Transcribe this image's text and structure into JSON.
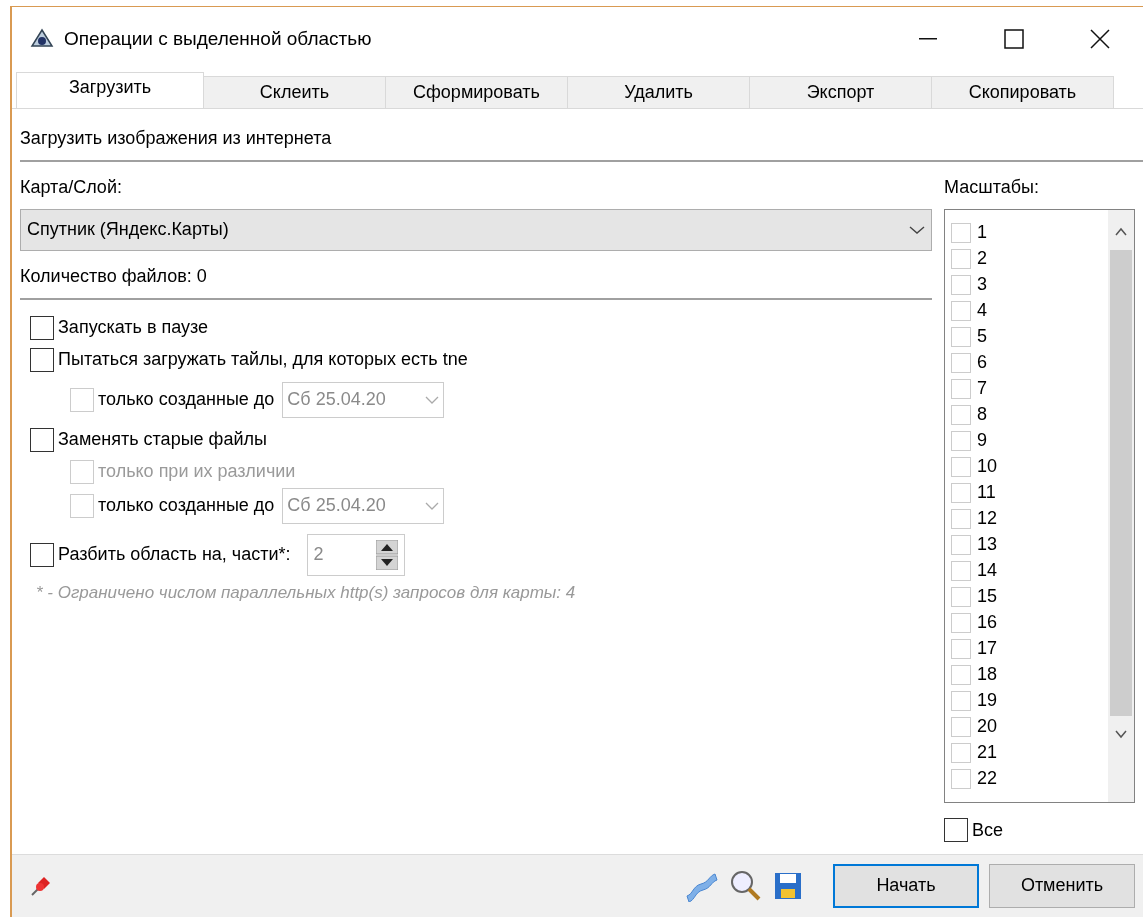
{
  "window": {
    "title": "Операции с выделенной областью"
  },
  "tabs": [
    {
      "label": "Загрузить",
      "selected": true
    },
    {
      "label": "Склеить",
      "selected": false
    },
    {
      "label": "Сформировать",
      "selected": false
    },
    {
      "label": "Удалить",
      "selected": false
    },
    {
      "label": "Экспорт",
      "selected": false
    },
    {
      "label": "Скопировать",
      "selected": false
    }
  ],
  "section_title": "Загрузить изображения из интернета",
  "map_layer": {
    "label": "Карта/Слой:",
    "value": "Спутник (Яндекс.Карты)"
  },
  "file_count": "Количество файлов: 0",
  "options": [
    {
      "kind": "checkbox",
      "label": "Запускать в паузе",
      "checked": false,
      "disabled": false,
      "dimmed": false
    },
    {
      "kind": "checkbox",
      "label": "Пытаться загружать тайлы, для которых есть tne",
      "checked": false,
      "disabled": false,
      "dimmed": false,
      "children": [
        {
          "kind": "date",
          "label": "только созданные до",
          "checked": false,
          "disabled": true,
          "dimmed": false,
          "date": "Сб 25.04.20"
        }
      ]
    },
    {
      "kind": "checkbox",
      "label": "Заменять старые файлы",
      "checked": false,
      "disabled": false,
      "dimmed": false,
      "children": [
        {
          "kind": "checkbox",
          "label": "только при их различии",
          "checked": false,
          "disabled": true,
          "dimmed": true
        },
        {
          "kind": "date",
          "label": "только созданные до",
          "checked": false,
          "disabled": true,
          "dimmed": false,
          "date": "Сб 25.04.20"
        }
      ]
    },
    {
      "kind": "spin",
      "label": "Разбить область на, части*:",
      "checked": false,
      "disabled": false,
      "dimmed": false,
      "value": "2"
    }
  ],
  "note": "* - Ограничено числом параллельных http(s) запросов для карты: 4",
  "scales": {
    "label": "Масштабы:",
    "items": [
      {
        "label": "1",
        "checked": false
      },
      {
        "label": "2",
        "checked": false
      },
      {
        "label": "3",
        "checked": false
      },
      {
        "label": "4",
        "checked": false
      },
      {
        "label": "5",
        "checked": false
      },
      {
        "label": "6",
        "checked": false
      },
      {
        "label": "7",
        "checked": false
      },
      {
        "label": "8",
        "checked": false
      },
      {
        "label": "9",
        "checked": false
      },
      {
        "label": "10",
        "checked": false
      },
      {
        "label": "11",
        "checked": false
      },
      {
        "label": "12",
        "checked": false
      },
      {
        "label": "13",
        "checked": false
      },
      {
        "label": "14",
        "checked": false
      },
      {
        "label": "15",
        "checked": false
      },
      {
        "label": "16",
        "checked": false
      },
      {
        "label": "17",
        "checked": false
      },
      {
        "label": "18",
        "checked": false
      },
      {
        "label": "19",
        "checked": false
      },
      {
        "label": "20",
        "checked": false
      },
      {
        "label": "21",
        "checked": false
      },
      {
        "label": "22",
        "checked": false
      }
    ],
    "all": {
      "label": "Все",
      "checked": false
    }
  },
  "buttons": [
    {
      "label": "Начать",
      "default": true
    },
    {
      "label": "Отменить",
      "default": false
    }
  ]
}
